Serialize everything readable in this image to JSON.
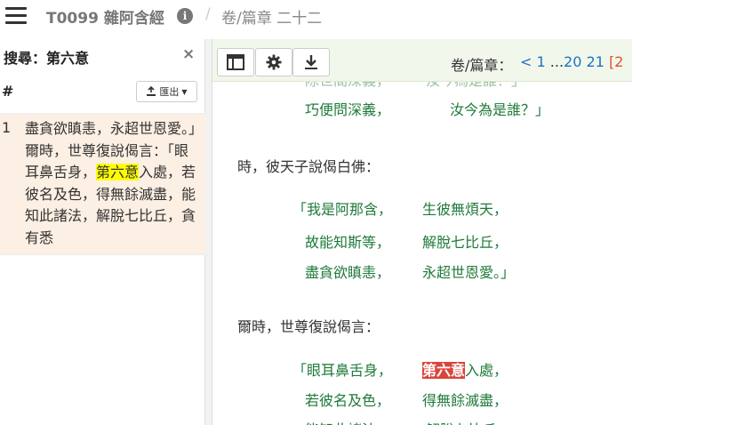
{
  "header": {
    "sutra_id": "T0099",
    "sutra_name": "雜阿含經",
    "separator": "/",
    "breadcrumb_label": "卷/篇章",
    "breadcrumb_value": "二十二"
  },
  "search_panel": {
    "title": "搜尋：第六意",
    "close_glyph": "×",
    "column_hash": "#",
    "export_label": "匯出",
    "result": {
      "number": "1",
      "text_before": "盡貪欲瞋恚，永超世恩愛。」爾時，世尊復說偈言：「眼耳鼻舌身，",
      "highlight": "第六意",
      "text_after": "入處，若彼名及色，得無餘滅盡，能知此諸法，解脫七比丘，貪有悉"
    }
  },
  "toolbar": {
    "juan_label": "卷/篇章：",
    "nav_prev": "< 1",
    "nav_dots": "...",
    "nav_page_20": "20",
    "nav_page_21": "21",
    "nav_current": "[2"
  },
  "reading": {
    "partial_top": "除世間深義，　　　汝今為是誰？」",
    "verse0_left": "巧便問深義，",
    "verse0_right": "汝今為是誰？」",
    "prose1": "時，彼天子說偈白佛：",
    "verse1": [
      {
        "left": "「我是阿那含，",
        "right": "生彼無煩天，"
      },
      {
        "left": "故能知斯等，",
        "right": "解脫七比丘，"
      },
      {
        "left": "盡貪欲瞋恚，",
        "right": "永超世恩愛。」"
      }
    ],
    "prose2": "爾時，世尊復說偈言：",
    "verse2_0_left": "「眼耳鼻舌身，",
    "verse2_0_highlight": "第六意",
    "verse2_0_right_rest": "入處，",
    "verse2_1_left": "若彼名及色，",
    "verse2_1_right": "得無餘滅盡，",
    "partial_bottom": "能知此諸法，　　　解脫七比丘，"
  },
  "icons": {
    "menu": "hamburger-icon",
    "info": "info-icon",
    "layout": "layout-panel-icon",
    "settings": "gear-icon",
    "download": "download-icon",
    "export": "export-icon"
  },
  "colors": {
    "verse_green": "#1f7a3a",
    "highlight_yellow": "#ffff00",
    "highlight_red": "#d9453b",
    "link_blue": "#1a73c7",
    "current_orange": "#e0522d",
    "result_bg": "#fcefe3",
    "toolbar_bg": "#f2f7ec"
  }
}
